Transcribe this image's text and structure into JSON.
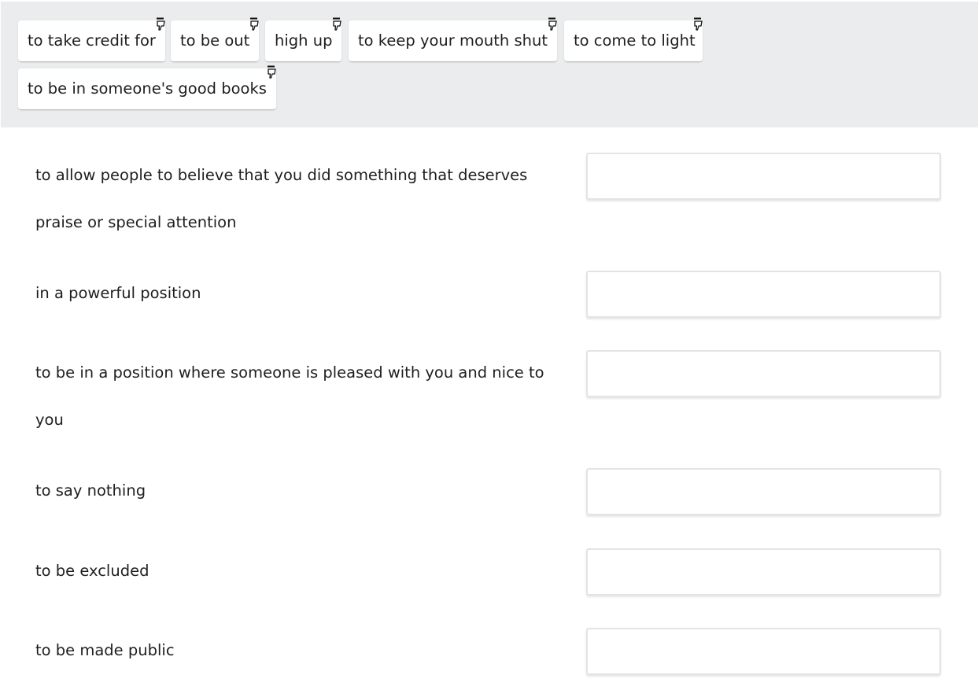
{
  "word_bank": {
    "chips": [
      {
        "label": "to take credit for",
        "icon": "drag-hand-icon"
      },
      {
        "label": "to be out",
        "icon": "drag-hand-icon"
      },
      {
        "label": "high up",
        "icon": "drag-hand-icon"
      },
      {
        "label": "to keep your mouth shut",
        "icon": "drag-hand-icon"
      },
      {
        "label": "to come to light",
        "icon": "drag-hand-icon"
      },
      {
        "label": "to be in someone's good books",
        "icon": "drag-hand-icon"
      }
    ]
  },
  "matching": {
    "definitions": [
      {
        "text": "to allow people to believe that you did something that deserves praise or special attention",
        "answer": ""
      },
      {
        "text": "in a powerful position",
        "answer": ""
      },
      {
        "text": "to be in a position where someone is pleased with you and nice to you",
        "answer": ""
      },
      {
        "text": "to say nothing",
        "answer": ""
      },
      {
        "text": "to be excluded",
        "answer": ""
      },
      {
        "text": "to be made public",
        "answer": ""
      }
    ]
  },
  "colors": {
    "bank_background": "#eaeced",
    "chip_background": "#ffffff",
    "drop_border": "#e4e4e4",
    "text": "#1e1e1e"
  }
}
